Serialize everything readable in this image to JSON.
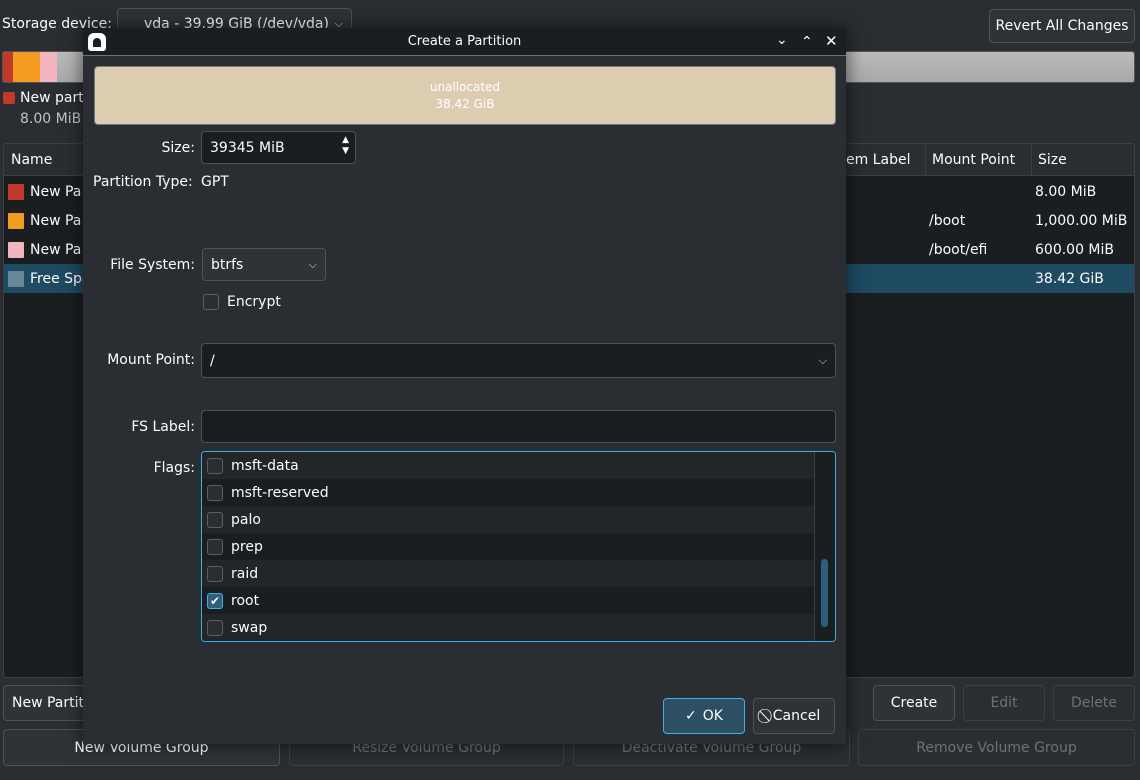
{
  "main": {
    "storage_label": "Storage device:",
    "storage_value": "vda - 39.99 GiB (/dev/vda)",
    "revert_button": "Revert All Changes",
    "legend_name": "New part",
    "legend_size": "8.00 MiB",
    "columns": [
      "Name",
      "em Label",
      "Mount Point",
      "Size"
    ],
    "rows": [
      {
        "name": "New Pa",
        "color": "#c0392b",
        "mount": "",
        "size": "8.00 MiB"
      },
      {
        "name": "New Pa",
        "color": "#f39c1f",
        "mount": "/boot",
        "size": "1,000.00 MiB"
      },
      {
        "name": "New Pa",
        "color": "#f3b5c0",
        "mount": "/boot/efi",
        "size": "600.00 MiB"
      },
      {
        "name": "Free Spa",
        "color": "#6a8799",
        "mount": "",
        "size": "38.42 GiB",
        "selected": true
      }
    ],
    "new_partition_button": "New Partit",
    "create_button": "Create",
    "edit_button": "Edit",
    "delete_button": "Delete",
    "new_vg_button": "New Volume Group",
    "resize_vg_button": "Resize Volume Group",
    "deactivate_vg_button": "Deactivate Volume Group",
    "remove_vg_button": "Remove Volume Group"
  },
  "dialog": {
    "title": "Create a Partition",
    "bar_label": "unallocated",
    "bar_size": "38.42 GiB",
    "size_label": "Size:",
    "size_value": "39345 MiB",
    "ptype_label": "Partition Type:",
    "ptype_value": "GPT",
    "fs_label": "File System:",
    "fs_value": "btrfs",
    "encrypt_label": "Encrypt",
    "mount_label": "Mount Point:",
    "mount_value": "/",
    "fslabel_label": "FS Label:",
    "fslabel_value": "",
    "flags_label": "Flags:",
    "flags": [
      {
        "name": "msft-data",
        "checked": false
      },
      {
        "name": "msft-reserved",
        "checked": false
      },
      {
        "name": "palo",
        "checked": false
      },
      {
        "name": "prep",
        "checked": false
      },
      {
        "name": "raid",
        "checked": false
      },
      {
        "name": "root",
        "checked": true
      },
      {
        "name": "swap",
        "checked": false
      }
    ],
    "ok_button": "OK",
    "cancel_button": "Cancel"
  },
  "colors": {
    "accent": "#3daee9",
    "bar_unallocated": "#dccdb0",
    "selection": "#1e4a62"
  }
}
